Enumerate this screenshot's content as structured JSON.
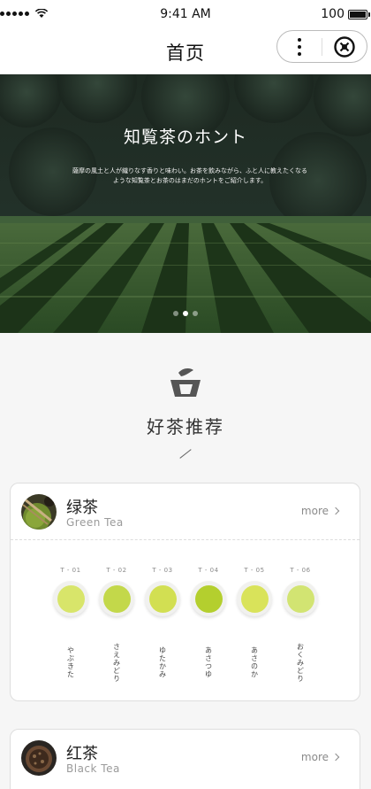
{
  "status": {
    "time": "9:41 AM",
    "battery": "100"
  },
  "nav": {
    "title": "首页"
  },
  "banner": {
    "title": "知覧茶のホント",
    "subtitle": "薩摩の風土と人が織りなす香りと味わい。お茶を飲みながら、ふと人に教えたくなるような知覧茶とお茶のはまだのホントをご紹介します。",
    "slides": 3,
    "active_slide": 2
  },
  "section": {
    "title": "好茶推荐"
  },
  "cards": [
    {
      "name": "绿茶",
      "en": "Green Tea",
      "more": "more",
      "teas": [
        {
          "code": "T - 01",
          "name": "やぶきた",
          "color": "#d8e56a"
        },
        {
          "code": "T - 02",
          "name": "さえみどり",
          "color": "#c3d84a"
        },
        {
          "code": "T - 03",
          "name": "ゆたかみ",
          "color": "#d2df52"
        },
        {
          "code": "T - 04",
          "name": "あさつゆ",
          "color": "#b4cf2e"
        },
        {
          "code": "T - 05",
          "name": "あさのか",
          "color": "#d9e35a"
        },
        {
          "code": "T - 06",
          "name": "おくみどり",
          "color": "#d2e472"
        }
      ]
    },
    {
      "name": "红茶",
      "en": "Black Tea",
      "more": "more"
    }
  ]
}
